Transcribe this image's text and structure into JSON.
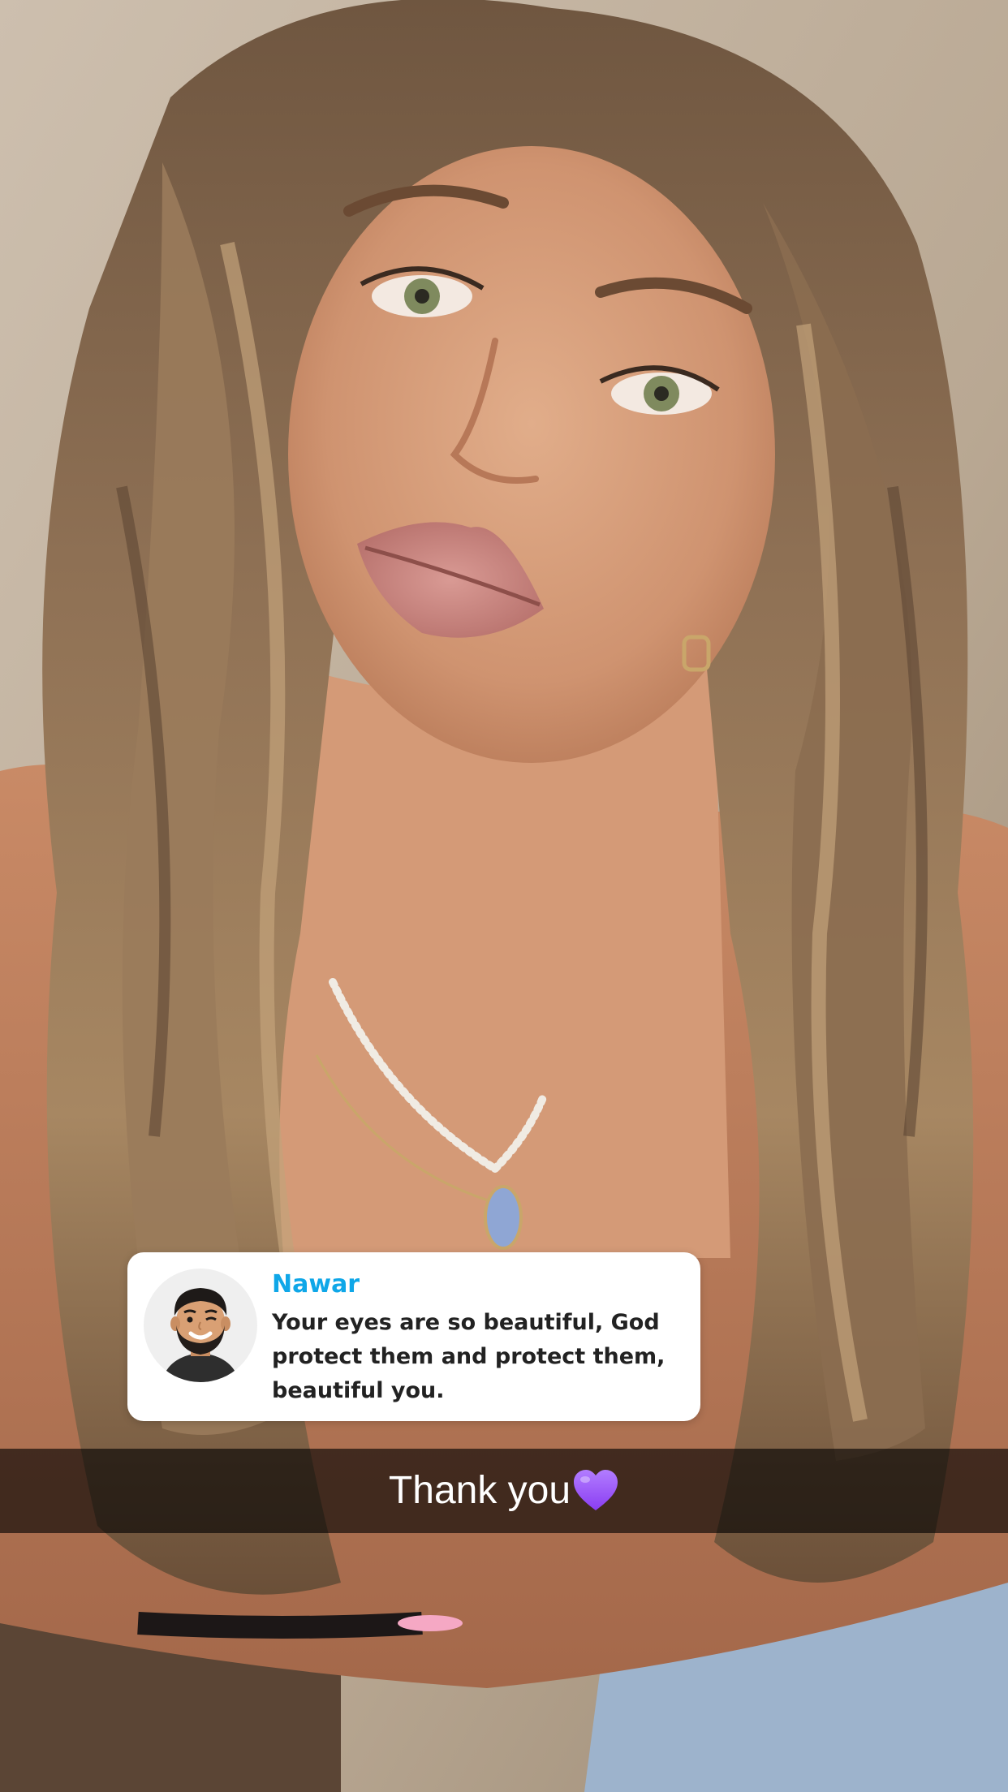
{
  "story": {
    "reply": {
      "sender_name": "Nawar",
      "message": "Your eyes are so beautiful, God protect them and protect them, beautiful you.",
      "avatar_icon": "bitmoji-avatar-icon"
    },
    "caption": {
      "text": "Thank you",
      "emoji_icon": "purple-heart-icon"
    }
  },
  "colors": {
    "sender_name": "#0fa7e8",
    "message_text": "#222222",
    "card_bg": "#ffffff",
    "caption_bar": "rgba(0,0,0,0.62)",
    "heart": "#9b4dff"
  }
}
